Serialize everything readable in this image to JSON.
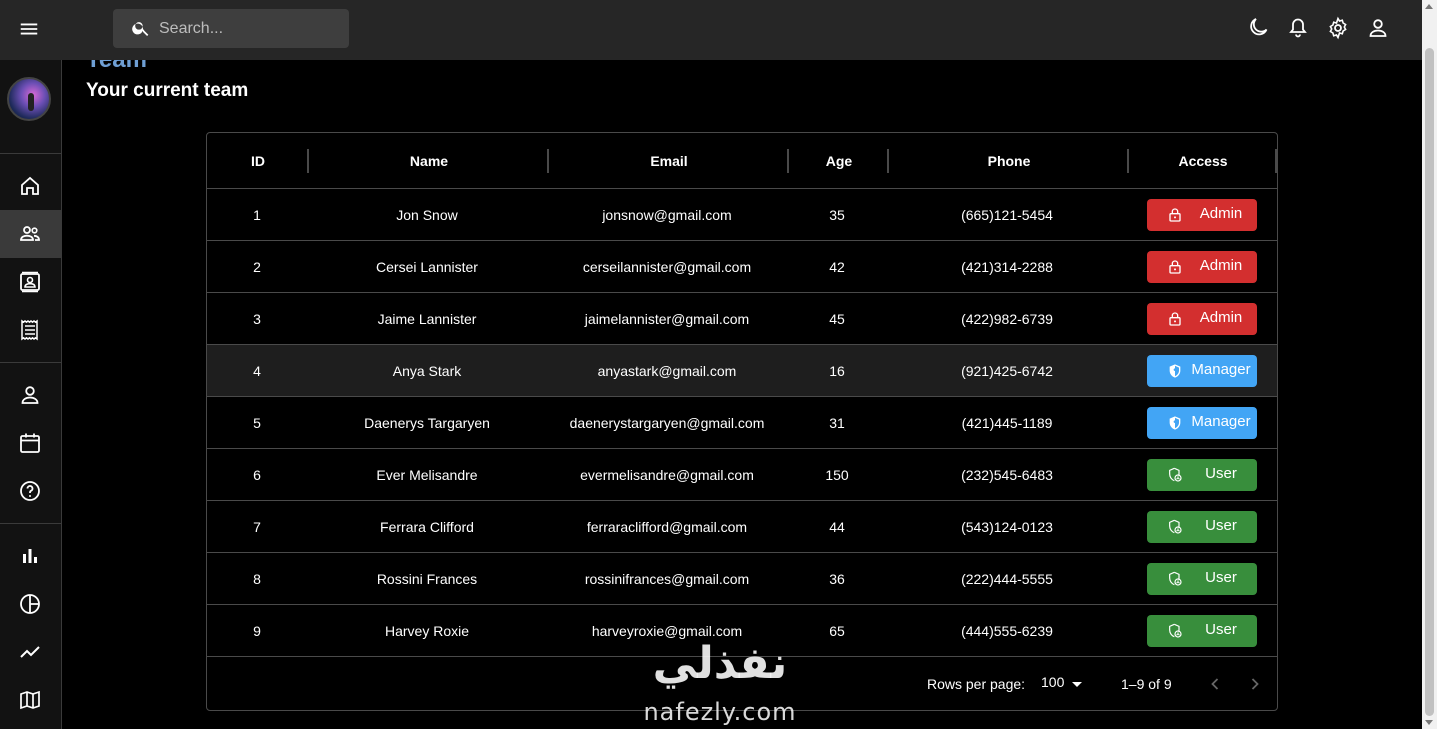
{
  "search": {
    "placeholder": "Search..."
  },
  "page": {
    "title": "Team",
    "subtitle": "Your current team"
  },
  "colors": {
    "admin": "#d32f2f",
    "manager": "#42a5f5",
    "user": "#388e3c",
    "title": "#6f9fd4"
  },
  "topbar_icons": [
    "menu-icon",
    "search-icon",
    "dark-mode-icon",
    "notifications-icon",
    "settings-icon",
    "person-icon"
  ],
  "sidebar": {
    "items": [
      {
        "icon": "home-icon"
      },
      {
        "icon": "team-icon",
        "active": true
      },
      {
        "icon": "contacts-icon"
      },
      {
        "icon": "invoices-icon"
      },
      {
        "icon": "profile-icon"
      },
      {
        "icon": "calendar-icon"
      },
      {
        "icon": "help-icon"
      },
      {
        "icon": "bar-chart-icon"
      },
      {
        "icon": "pie-chart-icon"
      },
      {
        "icon": "line-chart-icon"
      },
      {
        "icon": "map-icon"
      }
    ]
  },
  "table": {
    "headers": {
      "id": "ID",
      "name": "Name",
      "email": "Email",
      "age": "Age",
      "phone": "Phone",
      "access": "Access"
    },
    "rows": [
      {
        "id": "1",
        "name": "Jon Snow",
        "email": "jonsnow@gmail.com",
        "age": "35",
        "phone": "(665)121-5454",
        "access": "Admin"
      },
      {
        "id": "2",
        "name": "Cersei Lannister",
        "email": "cerseilannister@gmail.com",
        "age": "42",
        "phone": "(421)314-2288",
        "access": "Admin"
      },
      {
        "id": "3",
        "name": "Jaime Lannister",
        "email": "jaimelannister@gmail.com",
        "age": "45",
        "phone": "(422)982-6739",
        "access": "Admin"
      },
      {
        "id": "4",
        "name": "Anya Stark",
        "email": "anyastark@gmail.com",
        "age": "16",
        "phone": "(921)425-6742",
        "access": "Manager"
      },
      {
        "id": "5",
        "name": "Daenerys Targaryen",
        "email": "daenerystargaryen@gmail.com",
        "age": "31",
        "phone": "(421)445-1189",
        "access": "Manager"
      },
      {
        "id": "6",
        "name": "Ever Melisandre",
        "email": "evermelisandre@gmail.com",
        "age": "150",
        "phone": "(232)545-6483",
        "access": "User"
      },
      {
        "id": "7",
        "name": "Ferrara Clifford",
        "email": "ferraraclifford@gmail.com",
        "age": "44",
        "phone": "(543)124-0123",
        "access": "User"
      },
      {
        "id": "8",
        "name": "Rossini Frances",
        "email": "rossinifrances@gmail.com",
        "age": "36",
        "phone": "(222)444-5555",
        "access": "User"
      },
      {
        "id": "9",
        "name": "Harvey Roxie",
        "email": "harveyroxie@gmail.com",
        "age": "65",
        "phone": "(444)555-6239",
        "access": "User"
      }
    ],
    "footer": {
      "rows_per_page_label": "Rows per page:",
      "rows_per_page_value": "100",
      "page_info": "1–9 of 9"
    }
  },
  "watermark": {
    "arabic": "نفذلي",
    "latin": "nafezly.com"
  }
}
